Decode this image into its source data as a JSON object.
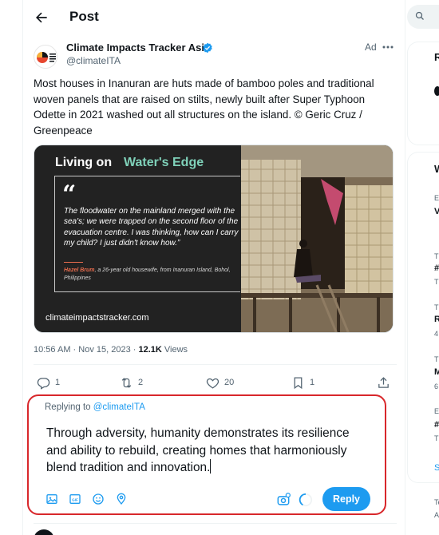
{
  "header": {
    "title": "Post"
  },
  "tweet": {
    "author_name": "Climate Impacts Tracker Asia",
    "author_handle": "@climateITA",
    "ad_label": "Ad",
    "text": "Most houses in Inanuran are huts made of bamboo poles and traditional woven panels that are raised on stilts, newly built after Super Typhoon Odette in 2021 washed out all structures on the island.  © Geric Cruz / Greenpeace",
    "media": {
      "title_part1": "Living on",
      "title_part2": "Water's Edge",
      "quote_mark": "“",
      "quote": "The floodwater on the mainland merged with the sea's; we were trapped on the second floor of the evacuation centre. I was thinking, how can I carry my child? I just didn't know how.”",
      "attribution_name": "Hazel Brum",
      "attribution_rest": ", a 26-year old housewife, from Inanuran Island, Bohol, Philippines",
      "watermark": "climateimpactstracker.com"
    },
    "time": "10:56 AM",
    "date": "Nov 15, 2023",
    "views_count": "12.1K",
    "views_label": "Views",
    "stats": {
      "replies": "1",
      "reposts": "2",
      "likes": "20",
      "bookmarks": "1"
    }
  },
  "reply": {
    "replying_to_prefix": "Replying to",
    "replying_to_handle": "@climateITA",
    "draft_text": "Through adversity, humanity demonstrates its resilience and ability to rebuild, creating homes that harmoniously blend tradition and innovation.",
    "reply_button": "Reply",
    "icons": [
      "image-icon",
      "gif-icon",
      "emoji-icon",
      "location-icon"
    ]
  },
  "right_column": {
    "panel1_letter": "R",
    "panel2_letter": "W",
    "items": [
      {
        "small": "E",
        "strong": "V"
      },
      {
        "small": "T",
        "strong": "#"
      },
      {
        "small": "T",
        "strong": "R"
      },
      {
        "small": "T",
        "strong": "M"
      },
      {
        "small": "E",
        "strong": "#"
      }
    ],
    "extra_small": [
      "T",
      "T",
      "4",
      "6",
      "T"
    ],
    "show_more": "S",
    "footer": [
      "Te",
      "A"
    ]
  },
  "colors": {
    "accent": "#1d9bf0",
    "highlight": "#d8272b",
    "text": "#0f1419",
    "muted": "#536471"
  }
}
